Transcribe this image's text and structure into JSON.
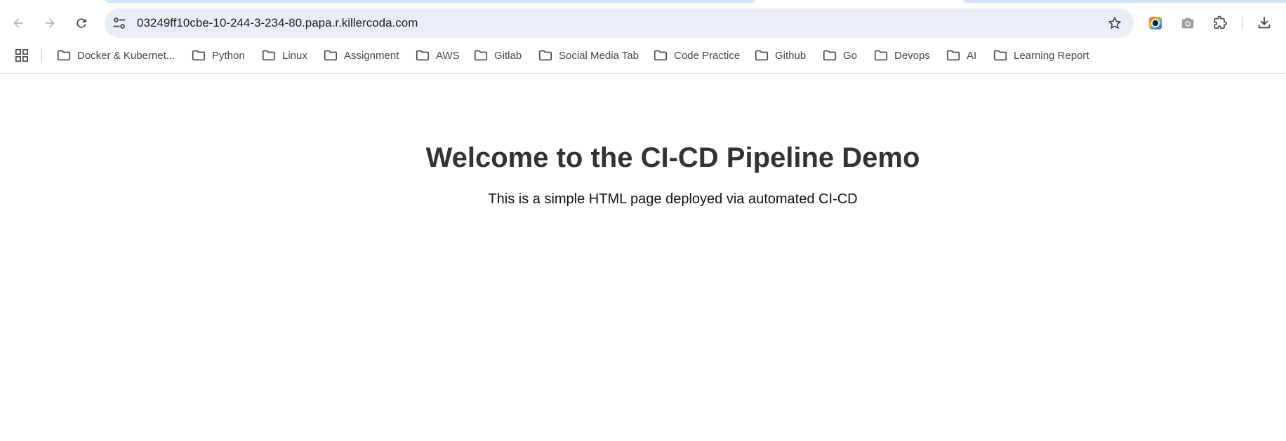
{
  "browser": {
    "url": "03249ff10cbe-10-244-3-234-80.papa.r.killercoda.com",
    "icons": {
      "back": "arrow-left-icon",
      "forward": "arrow-right-icon",
      "reload": "reload-icon",
      "site_info": "tune-icon",
      "bookmark_star": "star-icon",
      "extension_color": "color-picker-icon",
      "extension_camera": "camera-icon",
      "extensions": "puzzle-icon",
      "downloads": "download-icon",
      "apps": "apps-grid-icon",
      "folder": "folder-icon"
    },
    "colors": {
      "omnibox_bg": "#e9eef6",
      "tab_accent": "#d3e3fd",
      "icon": "#474747"
    }
  },
  "bookmarks": [
    {
      "label": "Docker & Kubernet..."
    },
    {
      "label": "Python"
    },
    {
      "label": "Linux"
    },
    {
      "label": "Assignment"
    },
    {
      "label": "AWS"
    },
    {
      "label": "Gitlab"
    },
    {
      "label": "Social Media Tab"
    },
    {
      "label": "Code Practice"
    },
    {
      "label": "Github"
    },
    {
      "label": "Go"
    },
    {
      "label": "Devops"
    },
    {
      "label": "AI"
    },
    {
      "label": "Learning Report"
    }
  ],
  "page": {
    "heading": "Welcome to the CI-CD Pipeline Demo",
    "paragraph": "This is a simple HTML page deployed via automated CI-CD",
    "colors": {
      "heading": "#333333",
      "text": "#111111"
    }
  }
}
